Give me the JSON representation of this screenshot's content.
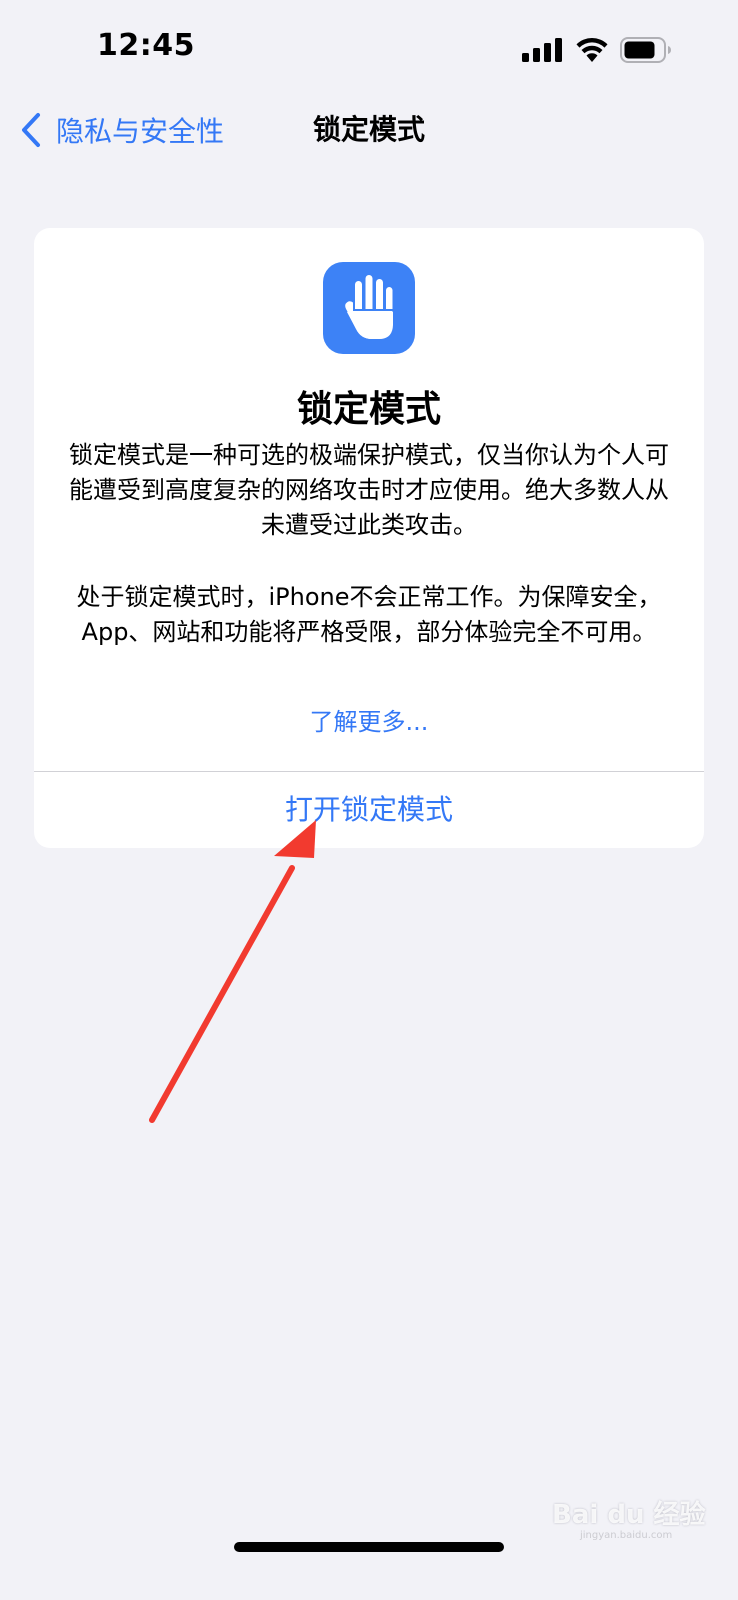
{
  "status_bar": {
    "time": "12:45",
    "icons": [
      "signal-icon",
      "wifi-icon",
      "battery-icon"
    ]
  },
  "nav": {
    "back_label": "隐私与安全性",
    "title": "锁定模式"
  },
  "card": {
    "icon": "hand-raised-icon",
    "title": "锁定模式",
    "description_1": "锁定模式是一种可选的极端保护模式，仅当你认为个人可能遭受到高度复杂的网络攻击时才应使用。绝大多数人从未遭受过此类攻击。",
    "description_2": "处于锁定模式时，iPhone不会正常工作。为保障安全，App、网站和功能将严格受限，部分体验完全不可用。",
    "learn_more": "了解更多...",
    "turn_on_button": "打开锁定模式"
  },
  "watermark": {
    "text": "Bai du 经验",
    "subtext": "jingyan.baidu.com"
  },
  "colors": {
    "accent": "#3478F6",
    "background": "#F2F2F7",
    "icon_tile": "#3D82F6",
    "annotation_arrow": "#F23A2F"
  }
}
